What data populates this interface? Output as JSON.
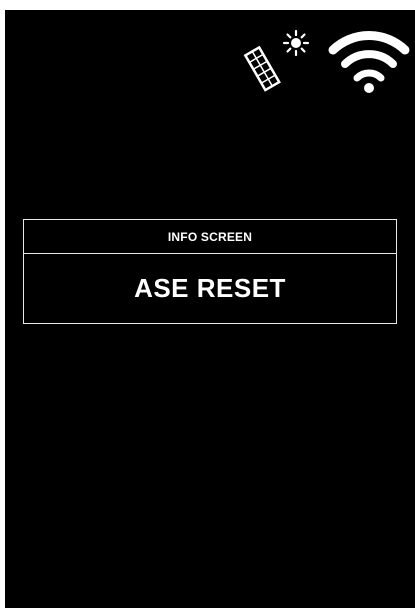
{
  "status_bar": {
    "icons": [
      "solar-panel-sun-icon",
      "wifi-icon"
    ]
  },
  "info_panel": {
    "title": "INFO SCREEN",
    "message": "ASE RESET"
  },
  "colors": {
    "background": "#000000",
    "foreground": "#ffffff",
    "border": "#e6e6e6",
    "bezel": "#ffffff"
  }
}
